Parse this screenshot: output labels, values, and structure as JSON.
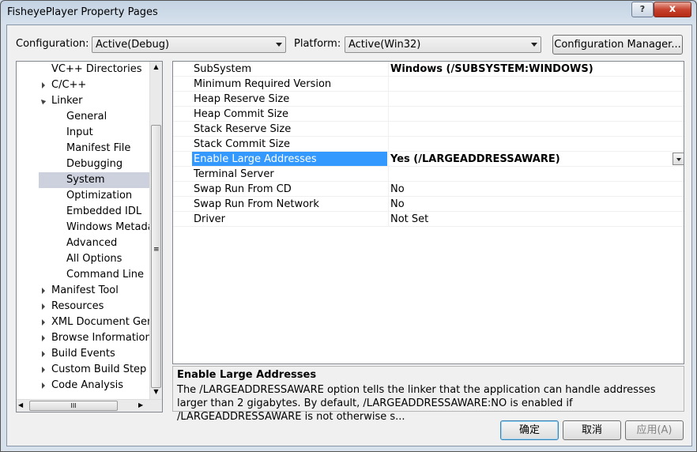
{
  "window": {
    "title": "FisheyePlayer Property Pages",
    "help": "?",
    "close": "x"
  },
  "config": {
    "configuration_label": "Configuration:",
    "configuration_value": "Active(Debug)",
    "platform_label": "Platform:",
    "platform_value": "Active(Win32)",
    "manager_button": "Configuration Manager..."
  },
  "tree": {
    "items": [
      {
        "label": "VC++ Directories"
      },
      {
        "label": "C/C++"
      },
      {
        "label": "Linker"
      },
      {
        "label": "General"
      },
      {
        "label": "Input"
      },
      {
        "label": "Manifest File"
      },
      {
        "label": "Debugging"
      },
      {
        "label": "System"
      },
      {
        "label": "Optimization"
      },
      {
        "label": "Embedded IDL"
      },
      {
        "label": "Windows Metadata"
      },
      {
        "label": "Advanced"
      },
      {
        "label": "All Options"
      },
      {
        "label": "Command Line"
      },
      {
        "label": "Manifest Tool"
      },
      {
        "label": "Resources"
      },
      {
        "label": "XML Document Generator"
      },
      {
        "label": "Browse Information"
      },
      {
        "label": "Build Events"
      },
      {
        "label": "Custom Build Step"
      },
      {
        "label": "Code Analysis"
      }
    ],
    "scroll_grip": "≡",
    "hscroll_grip": "III"
  },
  "grid": {
    "rows": [
      {
        "name": "SubSystem",
        "value": "Windows (/SUBSYSTEM:WINDOWS)"
      },
      {
        "name": "Minimum Required Version",
        "value": ""
      },
      {
        "name": "Heap Reserve Size",
        "value": ""
      },
      {
        "name": "Heap Commit Size",
        "value": ""
      },
      {
        "name": "Stack Reserve Size",
        "value": ""
      },
      {
        "name": "Stack Commit Size",
        "value": ""
      },
      {
        "name": "Enable Large Addresses",
        "value": "Yes (/LARGEADDRESSAWARE)"
      },
      {
        "name": "Terminal Server",
        "value": ""
      },
      {
        "name": "Swap Run From CD",
        "value": "No"
      },
      {
        "name": "Swap Run From Network",
        "value": "No"
      },
      {
        "name": "Driver",
        "value": "Not Set"
      }
    ]
  },
  "description": {
    "title": "Enable Large Addresses",
    "text": "The /LARGEADDRESSAWARE option tells the linker that the application can handle addresses larger than 2 gigabytes. By default, /LARGEADDRESSAWARE:NO is enabled if /LARGEADDRESSAWARE is not otherwise s..."
  },
  "buttons": {
    "ok": "确定",
    "cancel": "取消",
    "apply": "应用(A)"
  }
}
